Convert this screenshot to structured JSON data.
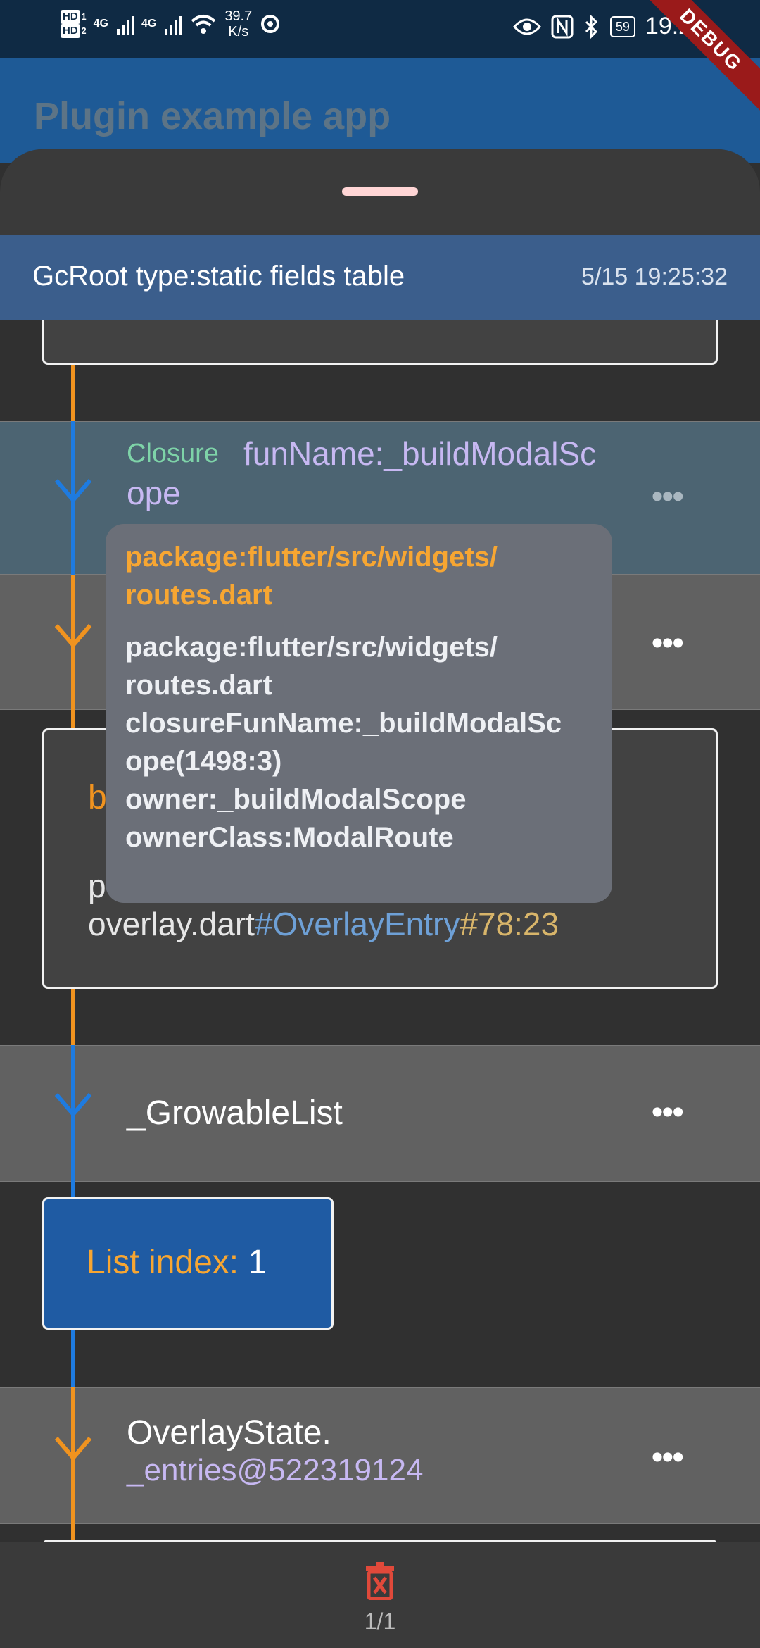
{
  "status_bar": {
    "hd1": "HD",
    "hd1_sub": "1",
    "hd2": "HD",
    "hd2_sub": "2",
    "sig1": "4G",
    "sig2": "4G",
    "speed_value": "39.7",
    "speed_unit": "K/s",
    "battery": "59",
    "time": "19:28"
  },
  "debug_banner": "DEBUG",
  "app_bar": {
    "title": "Plugin example app"
  },
  "gc_root": {
    "title": "GcRoot type:static fields table",
    "timestamp": "5/15 19:25:32"
  },
  "closure_row": {
    "type_label": "Closure",
    "fun_name_line1": "funName:_buildModalSc",
    "fun_name_line2": "ope"
  },
  "tooltip": {
    "header_line1": "package:flutter/src/widgets/",
    "header_line2": "routes.dart",
    "lines": [
      "package:flutter/src/widgets/",
      "routes.dart",
      "closureFunName:_buildModalSc",
      "ope(1498:3)",
      "owner:_buildModalScope",
      "ownerClass:ModalRoute"
    ]
  },
  "overlay_card": {
    "line1_prefix": "b",
    "line2_prefix": "p",
    "file": "overlay.dart",
    "class_ref": "#OverlayEntry",
    "location": "#78:23"
  },
  "growable_row": {
    "label": "_GrowableList"
  },
  "list_index": {
    "label": "List index: ",
    "value": "1"
  },
  "overlay_state_row": {
    "line1": "OverlayState.",
    "line2": "_entries@522319124"
  },
  "bottom_bar": {
    "pager": "1/1"
  },
  "colors": {
    "orange": "#f0931f",
    "blue": "#1e7be0",
    "green_label": "#7ed3a8",
    "purple_text": "#c7b8f2",
    "link_blue": "#6ea0d6",
    "gold": "#d8b56a"
  }
}
